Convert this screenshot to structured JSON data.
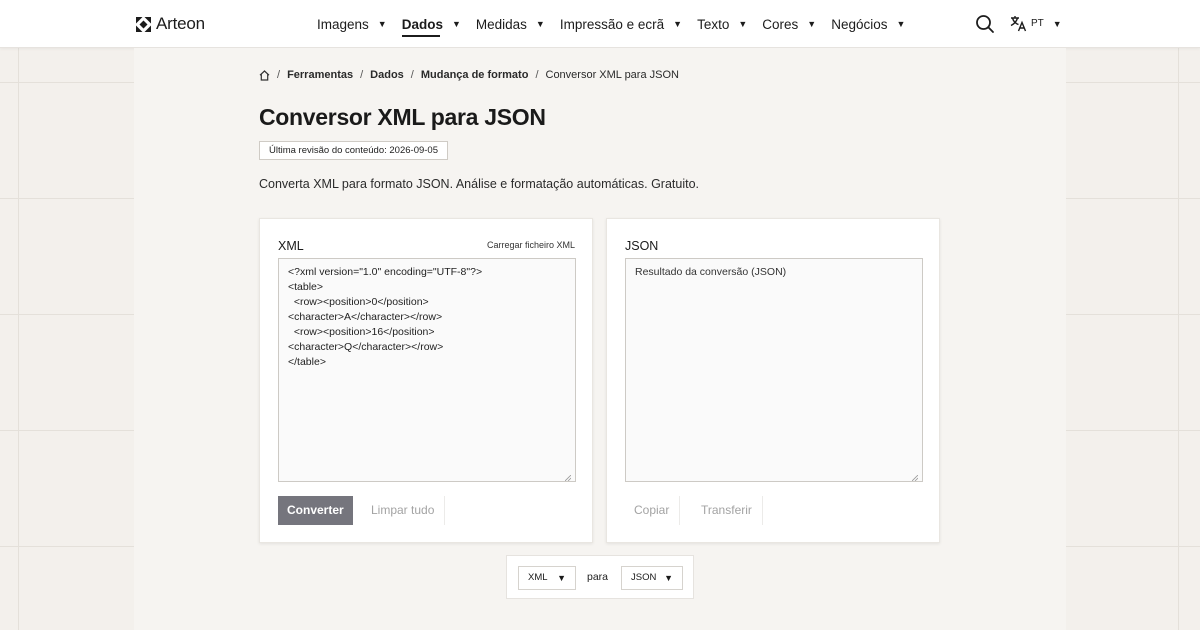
{
  "header": {
    "logo_text": "Arteon",
    "nav": [
      {
        "label": "Imagens",
        "active": false
      },
      {
        "label": "Dados",
        "active": true
      },
      {
        "label": "Medidas",
        "active": false
      },
      {
        "label": "Impressão e ecrã",
        "active": false
      },
      {
        "label": "Texto",
        "active": false
      },
      {
        "label": "Cores",
        "active": false
      },
      {
        "label": "Negócios",
        "active": false
      }
    ],
    "lang_code": "PT",
    "icons": [
      "logo-icon",
      "search-icon",
      "translate-icon",
      "caret-down-icon"
    ]
  },
  "breadcrumb": {
    "items": [
      "Ferramentas",
      "Dados",
      "Mudança de formato"
    ],
    "current": "Conversor XML para JSON",
    "separator": "/"
  },
  "page": {
    "title": "Conversor XML para JSON",
    "revision": "Última revisão do conteúdo: 2026-09-05",
    "description": "Converta XML para formato JSON. Análise e formatação automáticas. Gratuito."
  },
  "input_card": {
    "title": "XML",
    "upload_label": "Carregar ficheiro XML",
    "value": "<?xml version=\"1.0\" encoding=\"UTF-8\"?>\n<table>\n  <row><position>0</position>\n<character>A</character></row>\n  <row><position>16</position>\n<character>Q</character></row>\n</table>",
    "convert_label": "Converter",
    "clear_label": "Limpar tudo"
  },
  "output_card": {
    "title": "JSON",
    "placeholder": "Resultado da conversão (JSON)",
    "copy_label": "Copiar",
    "download_label": "Transferir"
  },
  "format_bar": {
    "from": "XML",
    "connector": "para",
    "to": "JSON"
  },
  "colors": {
    "primary_button": "#75757d",
    "page_background": "#f3f0ec",
    "panel_background": "#f6f4f1",
    "disabled_text": "#a3a3a3"
  }
}
